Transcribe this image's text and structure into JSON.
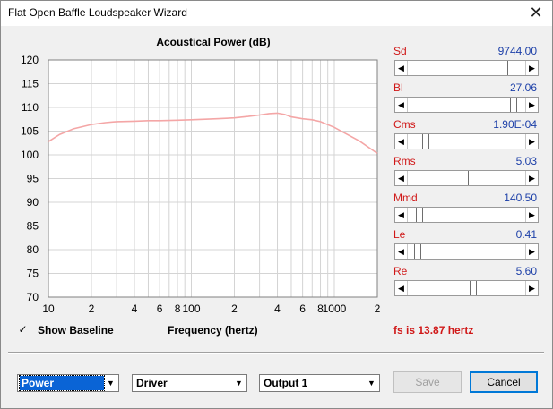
{
  "window": {
    "title": "Flat Open Baffle Loudspeaker Wizard",
    "close_glyph": "✕"
  },
  "chart_data": {
    "type": "line",
    "title": "Acoustical Power (dB)",
    "xlabel": "Frequency (hertz)",
    "ylabel": "",
    "x_scale": "log",
    "xlim": [
      10,
      2000
    ],
    "ylim": [
      70,
      120
    ],
    "y_ticks": [
      70,
      75,
      80,
      85,
      90,
      95,
      100,
      105,
      110,
      115,
      120
    ],
    "x_tick_labels": [
      {
        "value": 10,
        "label": "10"
      },
      {
        "value": 20,
        "label": "2"
      },
      {
        "value": 40,
        "label": "4"
      },
      {
        "value": 60,
        "label": "6"
      },
      {
        "value": 80,
        "label": "8"
      },
      {
        "value": 100,
        "label": "100"
      },
      {
        "value": 200,
        "label": "2"
      },
      {
        "value": 400,
        "label": "4"
      },
      {
        "value": 600,
        "label": "6"
      },
      {
        "value": 800,
        "label": "8"
      },
      {
        "value": 1000,
        "label": "1000"
      },
      {
        "value": 2000,
        "label": "2"
      }
    ],
    "grid": true,
    "line_color": "#f4a6a6",
    "series": [
      {
        "x": [
          10,
          12,
          15,
          20,
          25,
          30,
          40,
          50,
          60,
          80,
          100,
          150,
          200,
          250,
          300,
          350,
          400,
          450,
          500,
          600,
          700,
          800,
          1000,
          1200,
          1500,
          2000
        ],
        "y": [
          102.8,
          104.3,
          105.5,
          106.4,
          106.8,
          107.0,
          107.1,
          107.2,
          107.2,
          107.3,
          107.4,
          107.6,
          107.8,
          108.1,
          108.4,
          108.7,
          108.8,
          108.5,
          108.0,
          107.6,
          107.4,
          107.0,
          105.8,
          104.5,
          102.9,
          100.3
        ]
      }
    ]
  },
  "params": [
    {
      "label": "Sd",
      "value": "9744.00",
      "position": 0.91
    },
    {
      "label": "Bl",
      "value": "27.06",
      "position": 0.93
    },
    {
      "label": "Cms",
      "value": "1.90E-04",
      "position": 0.12
    },
    {
      "label": "Rms",
      "value": "5.03",
      "position": 0.49
    },
    {
      "label": "Mmd",
      "value": "140.50",
      "position": 0.07
    },
    {
      "label": "Le",
      "value": "0.41",
      "position": 0.05
    },
    {
      "label": "Re",
      "value": "5.60",
      "position": 0.56
    }
  ],
  "scroll_glyphs": {
    "left": "◀",
    "right": "▶"
  },
  "show_baseline": {
    "label": "Show Baseline",
    "checked": true,
    "check_glyph": "✓"
  },
  "status": "fs is 13.87 hertz",
  "combos": {
    "view": {
      "value": "Power"
    },
    "source": {
      "value": "Driver"
    },
    "output": {
      "value": "Output 1"
    },
    "arrow_glyph": "▼"
  },
  "buttons": {
    "save": "Save",
    "cancel": "Cancel"
  }
}
